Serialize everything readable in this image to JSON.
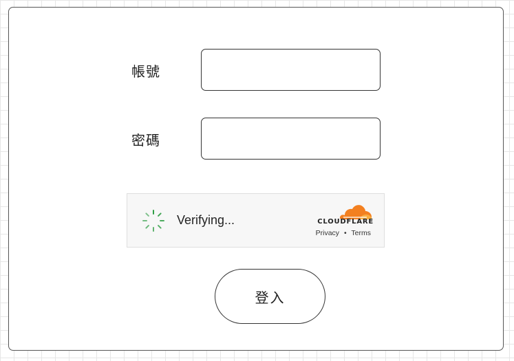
{
  "form": {
    "username_label": "帳號",
    "username_value": "",
    "password_label": "密碼",
    "password_value": "",
    "submit_label": "登入"
  },
  "captcha": {
    "status_text": "Verifying...",
    "brand_name": "CLOUDFLARE",
    "privacy_label": "Privacy",
    "separator": "•",
    "terms_label": "Terms",
    "spinner_icon": "loading-spinner-icon",
    "logo_icon": "cloudflare-cloud-icon",
    "spinner_color": "#2f9e44",
    "brand_color": "#f38020"
  }
}
